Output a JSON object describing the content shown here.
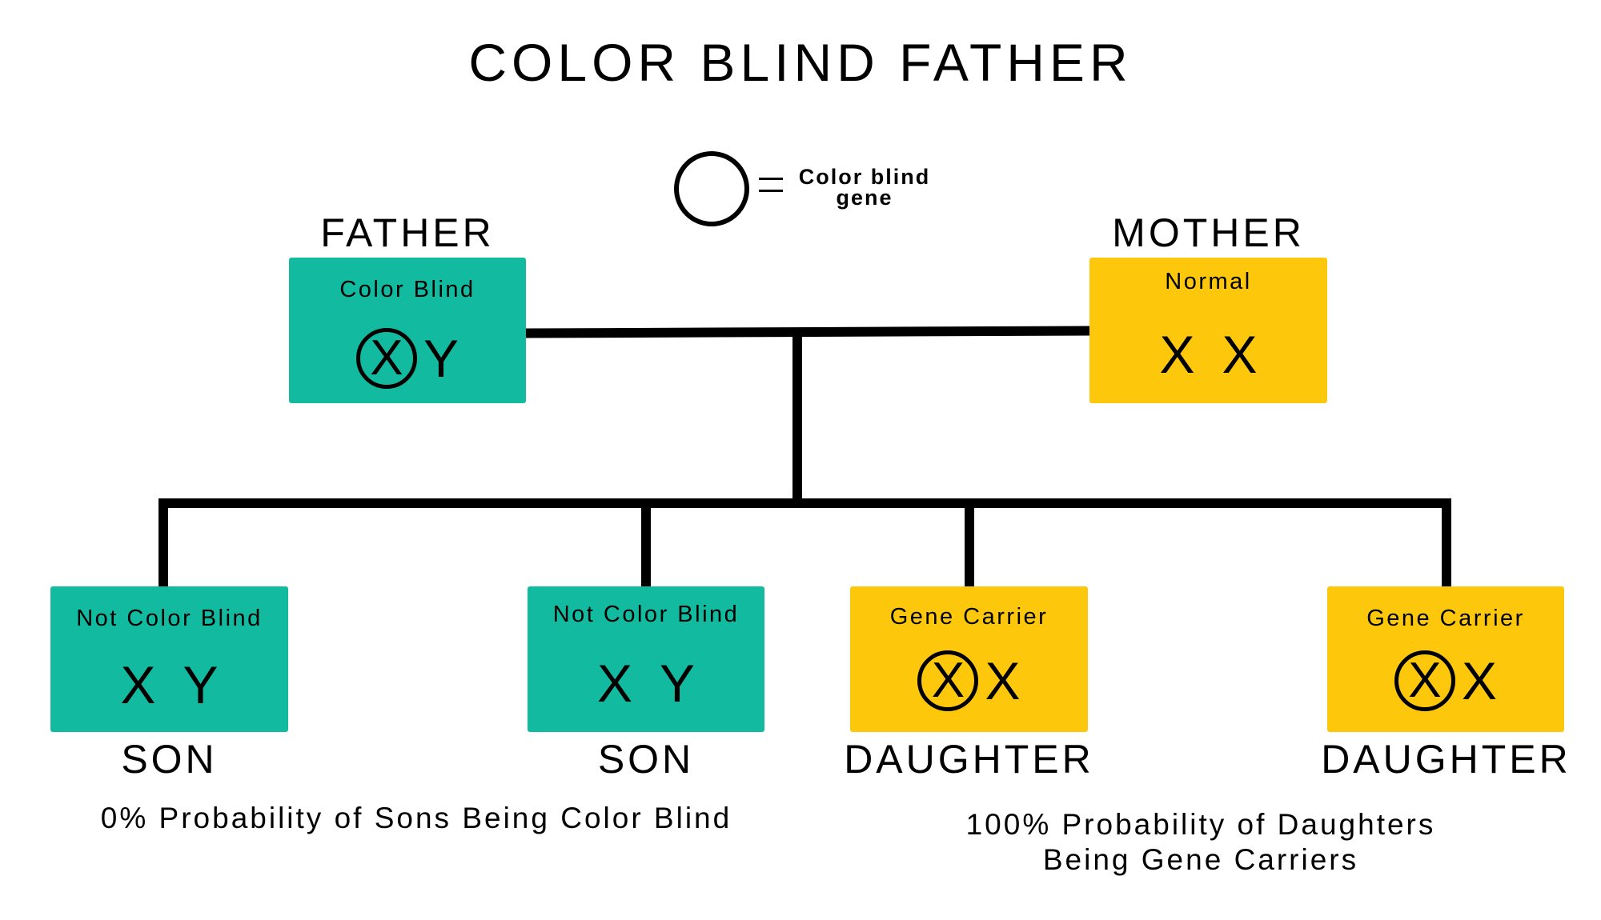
{
  "title": "COLOR BLIND FATHER",
  "legend": {
    "symbol_icon": "circle-outline-icon",
    "equals": "=",
    "line1": "Color blind",
    "line2": "gene"
  },
  "colors": {
    "teal": "#12BBA0",
    "yellow": "#FDC80C",
    "ink": "#000000"
  },
  "parents": [
    {
      "role": "FATHER",
      "status": "Color Blind",
      "chromosomes": [
        {
          "label": "X",
          "carries_gene": true
        },
        {
          "label": "Y",
          "carries_gene": false
        }
      ],
      "color": "teal"
    },
    {
      "role": "MOTHER",
      "status": "Normal",
      "chromosomes": [
        {
          "label": "X",
          "carries_gene": false
        },
        {
          "label": "X",
          "carries_gene": false
        }
      ],
      "color": "yellow"
    }
  ],
  "children": [
    {
      "role": "SON",
      "status": "Not Color Blind",
      "chromosomes": [
        {
          "label": "X",
          "carries_gene": false
        },
        {
          "label": "Y",
          "carries_gene": false
        }
      ],
      "color": "teal"
    },
    {
      "role": "SON",
      "status": "Not Color Blind",
      "chromosomes": [
        {
          "label": "X",
          "carries_gene": false
        },
        {
          "label": "Y",
          "carries_gene": false
        }
      ],
      "color": "teal"
    },
    {
      "role": "DAUGHTER",
      "status": "Gene Carrier",
      "chromosomes": [
        {
          "label": "X",
          "carries_gene": true
        },
        {
          "label": "X",
          "carries_gene": false
        }
      ],
      "color": "yellow"
    },
    {
      "role": "DAUGHTER",
      "status": "Gene Carrier",
      "chromosomes": [
        {
          "label": "X",
          "carries_gene": true
        },
        {
          "label": "X",
          "carries_gene": false
        }
      ],
      "color": "yellow"
    }
  ],
  "captions": {
    "sons": "0% Probability of Sons Being Color Blind",
    "daughters_line1": "100% Probability of Daughters",
    "daughters_line2": "Being Gene Carriers"
  }
}
